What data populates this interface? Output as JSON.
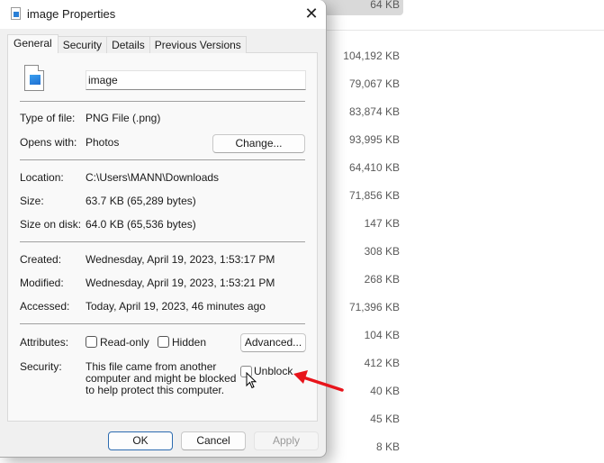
{
  "background": {
    "selected_row_size": "64 KB",
    "sizes": [
      "104,192 KB",
      "79,067 KB",
      "83,874 KB",
      "93,995 KB",
      "64,410 KB",
      "71,856 KB",
      "147 KB",
      "308 KB",
      "268 KB",
      "71,396 KB",
      "104 KB",
      "412 KB",
      "40 KB",
      "45 KB",
      "8 KB"
    ]
  },
  "dialog": {
    "title": "image Properties",
    "close_icon": "close-icon",
    "tabs": [
      {
        "label": "General",
        "active": true
      },
      {
        "label": "Security",
        "active": false
      },
      {
        "label": "Details",
        "active": false
      },
      {
        "label": "Previous Versions",
        "active": false
      }
    ],
    "file_name": "image",
    "type_of_file": {
      "label": "Type of file:",
      "value": "PNG File (.png)"
    },
    "opens_with": {
      "label": "Opens with:",
      "value": "Photos",
      "button": "Change..."
    },
    "location": {
      "label": "Location:",
      "value": "C:\\Users\\MANN\\Downloads"
    },
    "size": {
      "label": "Size:",
      "value": "63.7 KB (65,289 bytes)"
    },
    "size_on_disk": {
      "label": "Size on disk:",
      "value": "64.0 KB (65,536 bytes)"
    },
    "created": {
      "label": "Created:",
      "value": "Wednesday, April 19, 2023, 1:53:17 PM"
    },
    "modified": {
      "label": "Modified:",
      "value": "Wednesday, April 19, 2023, 1:53:21 PM"
    },
    "accessed": {
      "label": "Accessed:",
      "value": "Today, April 19, 2023, 46 minutes ago"
    },
    "attributes": {
      "label": "Attributes:",
      "read_only": {
        "label": "Read-only",
        "checked": false
      },
      "hidden": {
        "label": "Hidden",
        "checked": false
      },
      "advanced_button": "Advanced..."
    },
    "security": {
      "label": "Security:",
      "message": "This file came from another computer and might be blocked to help protect this computer.",
      "unblock": {
        "label": "Unblock",
        "checked": false
      }
    },
    "footer": {
      "ok": "OK",
      "cancel": "Cancel",
      "apply": "Apply",
      "apply_enabled": false
    },
    "annotation_color": "#e8141b"
  }
}
